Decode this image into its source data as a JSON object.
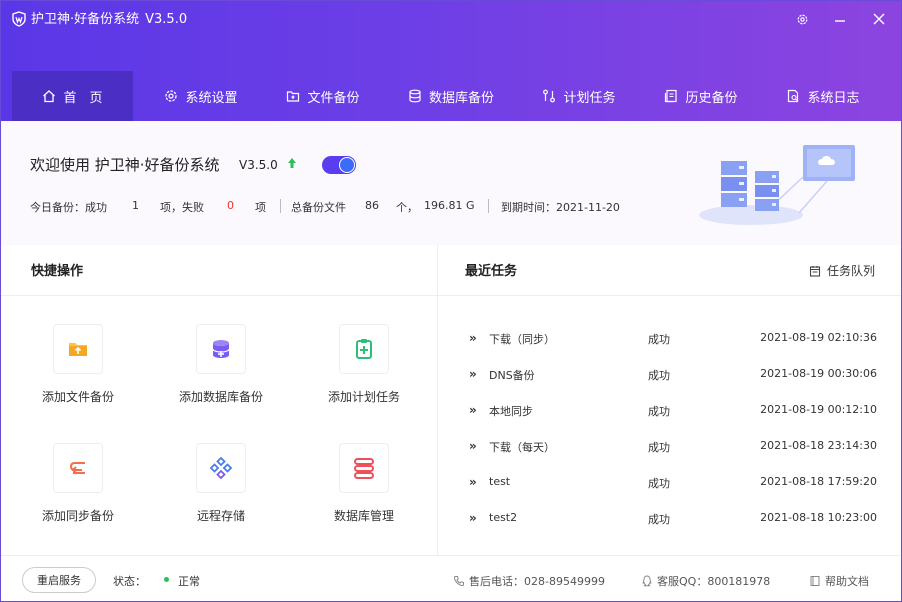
{
  "app": {
    "title": "护卫神·好备份系统",
    "version": "V3.5.0"
  },
  "nav": [
    {
      "label": "首　页",
      "icon": "home-icon"
    },
    {
      "label": "系统设置",
      "icon": "gear-icon"
    },
    {
      "label": "文件备份",
      "icon": "folder-icon"
    },
    {
      "label": "数据库备份",
      "icon": "database-icon"
    },
    {
      "label": "计划任务",
      "icon": "task-icon"
    },
    {
      "label": "历史备份",
      "icon": "history-icon"
    },
    {
      "label": "系统日志",
      "icon": "log-icon"
    }
  ],
  "welcome": {
    "greeting": "欢迎使用 护卫神·好备份系统",
    "version": "V3.5.0",
    "today_label": "今日备份：成功",
    "success_count": "1",
    "fail_label": "项，失败",
    "fail_count": "0",
    "item_unit": "项",
    "total_label": "总备份文件",
    "total_count": "86",
    "count_unit": "个，",
    "total_size": "196.81",
    "size_unit": "G",
    "expire_label": "到期时间：2021-11-20"
  },
  "quick": {
    "title": "快捷操作",
    "items": [
      {
        "label": "添加文件备份",
        "icon": "folder-upload-icon",
        "color": "#f5a623"
      },
      {
        "label": "添加数据库备份",
        "icon": "database-add-icon",
        "color": "#7a5cf0"
      },
      {
        "label": "添加计划任务",
        "icon": "clipboard-add-icon",
        "color": "#2bbf77"
      },
      {
        "label": "添加同步备份",
        "icon": "sync-icon",
        "color": "#f36d4f"
      },
      {
        "label": "远程存储",
        "icon": "remote-storage-icon",
        "color": "#4a7bf0"
      },
      {
        "label": "数据库管理",
        "icon": "database-manage-icon",
        "color": "#ef4f5a"
      }
    ]
  },
  "recent": {
    "title": "最近任务",
    "queue_label": "任务队列",
    "tasks": [
      {
        "name": "下载（同步）",
        "status": "成功",
        "time": "2021-08-19 02:10:36"
      },
      {
        "name": "DNS备份",
        "status": "成功",
        "time": "2021-08-19 00:30:06"
      },
      {
        "name": "本地同步",
        "status": "成功",
        "time": "2021-08-19 00:12:10"
      },
      {
        "name": "下载（每天）",
        "status": "成功",
        "time": "2021-08-18 23:14:30"
      },
      {
        "name": "test",
        "status": "成功",
        "time": "2021-08-18 17:59:20"
      },
      {
        "name": "test2",
        "status": "成功",
        "time": "2021-08-18 10:23:00"
      }
    ]
  },
  "footer": {
    "restart_label": "重启服务",
    "status_label": "状态：",
    "status_value": "正常",
    "phone": "售后电话：028-89549999",
    "qq": "客服QQ：800181978",
    "help": "帮助文档"
  },
  "colors": {
    "header_start": "#5a37e6",
    "header_end": "#8c44e0",
    "accent": "#5a3df0",
    "success": "#2bbf57",
    "danger": "#e33333"
  }
}
